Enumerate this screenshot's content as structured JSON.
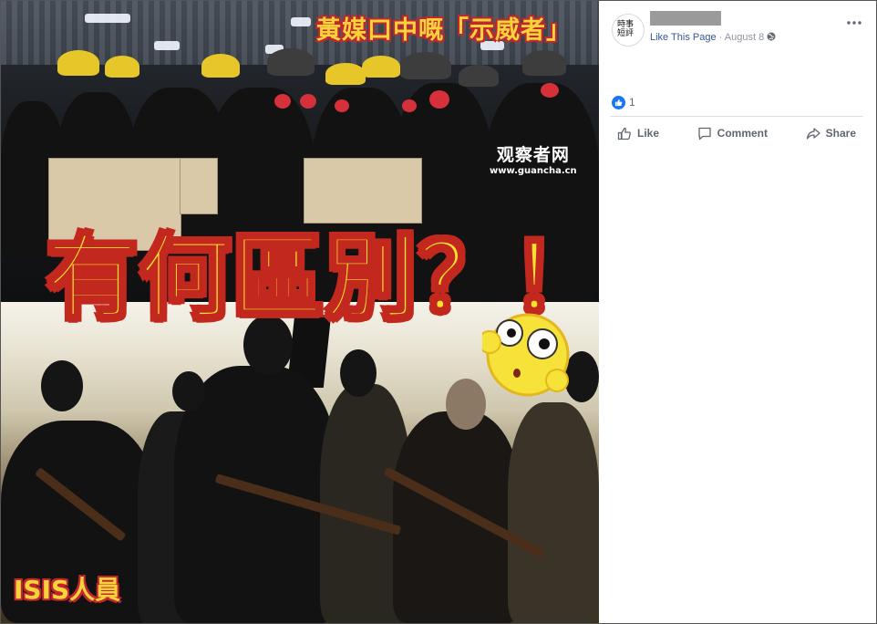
{
  "image": {
    "caption_top": "黃媒口中嘅「示威者」",
    "headline": "有何區別？！",
    "watermark_title": "观察者网",
    "watermark_url": "www.guancha.cn",
    "caption_bottom": "ISIS人員"
  },
  "post": {
    "author_name": "",
    "avatar_text": "時事短評",
    "like_page_label": "Like This Page",
    "separator": "·",
    "date": "August 8",
    "privacy_icon": "globe-icon",
    "more_icon": "more-icon",
    "reaction_icon": "thumbs-up-icon",
    "reaction_count": "1"
  },
  "actions": [
    {
      "label": "Like",
      "icon": "thumbs-up-icon"
    },
    {
      "label": "Comment",
      "icon": "comment-icon"
    },
    {
      "label": "Share",
      "icon": "share-icon"
    }
  ],
  "colors": {
    "link": "#365899",
    "reaction_blue": "#1877f2",
    "caption_yellow": "#f6d33a",
    "caption_red": "#c1272d"
  }
}
